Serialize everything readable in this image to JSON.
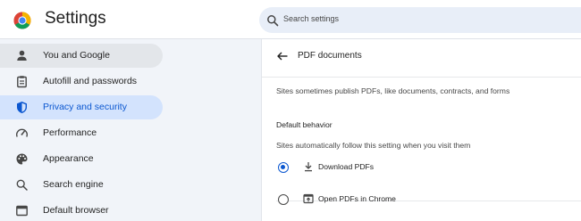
{
  "header": {
    "title": "Settings",
    "search_placeholder": "Search settings"
  },
  "sidebar": {
    "items": [
      {
        "label": "You and Google",
        "icon": "person-icon",
        "state": "hover"
      },
      {
        "label": "Autofill and passwords",
        "icon": "clipboard-icon",
        "state": ""
      },
      {
        "label": "Privacy and security",
        "icon": "shield-icon",
        "state": "active"
      },
      {
        "label": "Performance",
        "icon": "speedometer-icon",
        "state": ""
      },
      {
        "label": "Appearance",
        "icon": "palette-icon",
        "state": ""
      },
      {
        "label": "Search engine",
        "icon": "search-icon",
        "state": ""
      },
      {
        "label": "Default browser",
        "icon": "browser-icon",
        "state": ""
      }
    ]
  },
  "main": {
    "page_title": "PDF documents",
    "description": "Sites sometimes publish PDFs, like documents, contracts, and forms",
    "section_title": "Default behavior",
    "section_description": "Sites automatically follow this setting when you visit them",
    "options": [
      {
        "label": "Download PDFs",
        "icon": "download-icon",
        "checked": true
      },
      {
        "label": "Open PDFs in Chrome",
        "icon": "open-in-browser-icon",
        "checked": false
      }
    ]
  },
  "colors": {
    "accent": "#0b57d0",
    "active_bg": "#d3e3fd",
    "sidebar_bg": "#f1f4f9",
    "search_bg": "#e8eef8"
  }
}
